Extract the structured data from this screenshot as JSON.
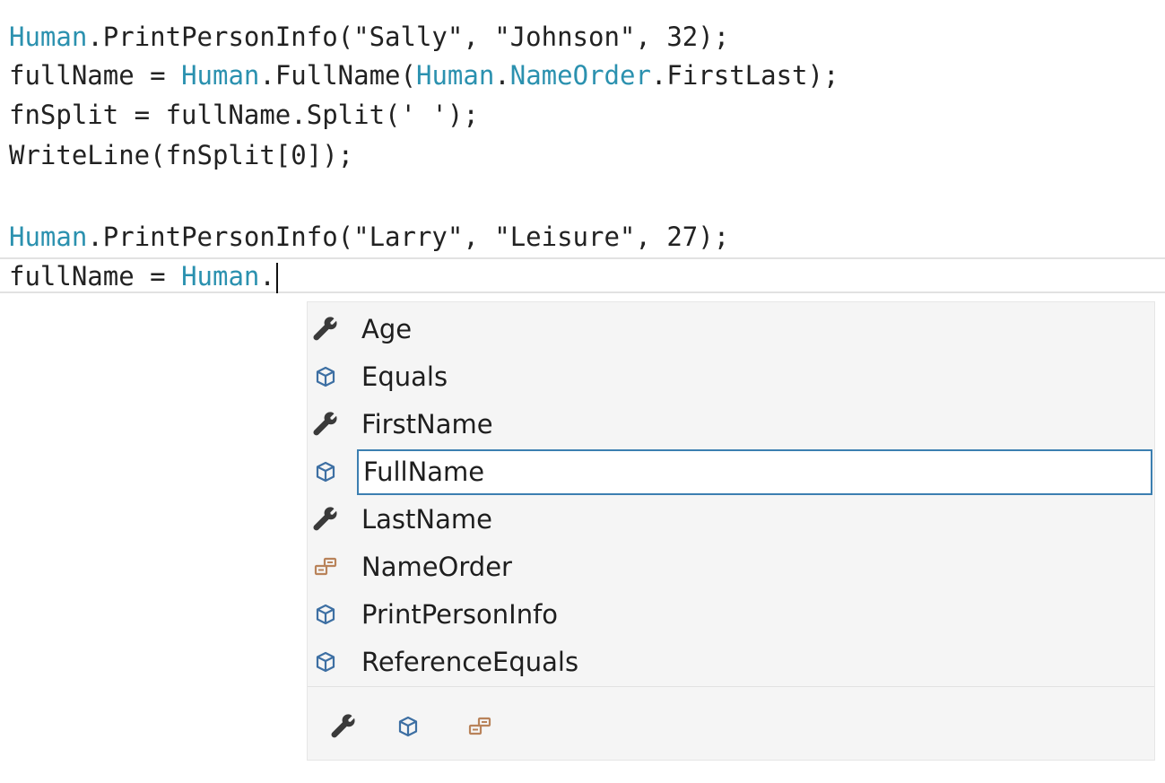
{
  "editor": {
    "code_lines": [
      {
        "tokens": [
          {
            "text": "Human",
            "color": "#2b91af"
          },
          {
            "text": ".PrintPersonInfo(\"Sally\", \"Johnson\", 32);",
            "color": "#222222"
          }
        ]
      },
      {
        "tokens": [
          {
            "text": "fullName = ",
            "color": "#222222"
          },
          {
            "text": "Human",
            "color": "#2b91af"
          },
          {
            "text": ".FullName(",
            "color": "#222222"
          },
          {
            "text": "Human",
            "color": "#2b91af"
          },
          {
            "text": ".",
            "color": "#222222"
          },
          {
            "text": "NameOrder",
            "color": "#2b91af"
          },
          {
            "text": ".FirstLast);",
            "color": "#222222"
          }
        ]
      },
      {
        "tokens": [
          {
            "text": "fnSplit = fullName.Split(' ');",
            "color": "#222222"
          }
        ]
      },
      {
        "tokens": [
          {
            "text": "WriteLine(fnSplit[0]);",
            "color": "#222222"
          }
        ]
      },
      {
        "tokens": [
          {
            "text": "Human",
            "color": "#2b91af"
          },
          {
            "text": ".PrintPersonInfo(\"Larry\", \"Leisure\", 27);",
            "color": "#222222"
          }
        ]
      },
      {
        "tokens": [
          {
            "text": "fullName = ",
            "color": "#222222"
          },
          {
            "text": "Human",
            "color": "#2b91af"
          },
          {
            "text": ".",
            "color": "#222222"
          }
        ]
      }
    ]
  },
  "completion": {
    "items": [
      {
        "label": "Age",
        "icon": "wrench-icon",
        "kind": "property"
      },
      {
        "label": "Equals",
        "icon": "cube-icon",
        "kind": "method"
      },
      {
        "label": "FirstName",
        "icon": "wrench-icon",
        "kind": "property"
      },
      {
        "label": "FullName",
        "icon": "cube-icon",
        "kind": "method",
        "selected": true
      },
      {
        "label": "LastName",
        "icon": "wrench-icon",
        "kind": "property"
      },
      {
        "label": "NameOrder",
        "icon": "enum-icon",
        "kind": "enum"
      },
      {
        "label": "PrintPersonInfo",
        "icon": "cube-icon",
        "kind": "method"
      },
      {
        "label": "ReferenceEquals",
        "icon": "cube-icon",
        "kind": "method"
      }
    ],
    "filters": [
      {
        "icon": "wrench-icon",
        "kind": "property"
      },
      {
        "icon": "cube-icon",
        "kind": "method"
      },
      {
        "icon": "enum-icon",
        "kind": "enum"
      }
    ]
  },
  "colors": {
    "type_name": "#2b91af",
    "code_text": "#222222",
    "selection_border": "#3c7fb1",
    "popup_background": "#f5f5f5",
    "method_icon": "#3d6fa3",
    "property_icon": "#3a3a3a",
    "enum_icon": "#b9835a"
  }
}
